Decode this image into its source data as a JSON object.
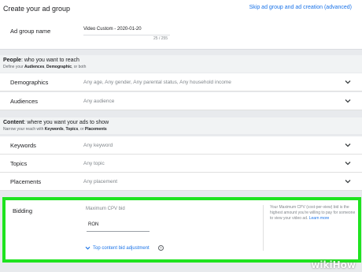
{
  "top": {
    "title": "Create your ad group",
    "skip_link": "Skip ad group and ad creation (advanced)",
    "ad_group_name_label": "Ad group name",
    "ad_group_name_value": "Video Custom - 2020-01-20",
    "ad_group_name_counter": "25 / 255"
  },
  "people": {
    "title_bold": "People",
    "title_rest": ": who you want to reach",
    "sub_prefix": "Define your ",
    "sub_bold1": "Audiences",
    "sub_mid": ", ",
    "sub_bold2": "Demographic",
    "sub_suffix": ", or both",
    "rows": [
      {
        "label": "Demographics",
        "value": "Any age, Any gender, Any parental status, Any household income"
      },
      {
        "label": "Audiences",
        "value": "Any audience"
      }
    ]
  },
  "content": {
    "title_bold": "Content",
    "title_rest": ": where you want your ads to show",
    "sub_prefix": "Narrow your reach with ",
    "sub_bold1": "Keywords",
    "sub_mid1": ", ",
    "sub_bold2": "Topics",
    "sub_mid2": ", or ",
    "sub_bold3": "Placements",
    "rows": [
      {
        "label": "Keywords",
        "value": "Any keyword"
      },
      {
        "label": "Topics",
        "value": "Any topic"
      },
      {
        "label": "Placements",
        "value": "Any placement"
      }
    ]
  },
  "bidding": {
    "label": "Bidding",
    "field_label": "Maximum CPV bid",
    "currency": "RON",
    "adjust_link": "Top content bid adjustment",
    "help_icon": "?",
    "help_text": "Your Maximum CPV (cost-per-view) bid is the highest amount you're willing to pay for someone to view your video ad.",
    "learn_more": "Learn more"
  },
  "watermark": "wikiHow",
  "colors": {
    "accent": "#1a73e8",
    "highlight": "#1fe31f"
  }
}
